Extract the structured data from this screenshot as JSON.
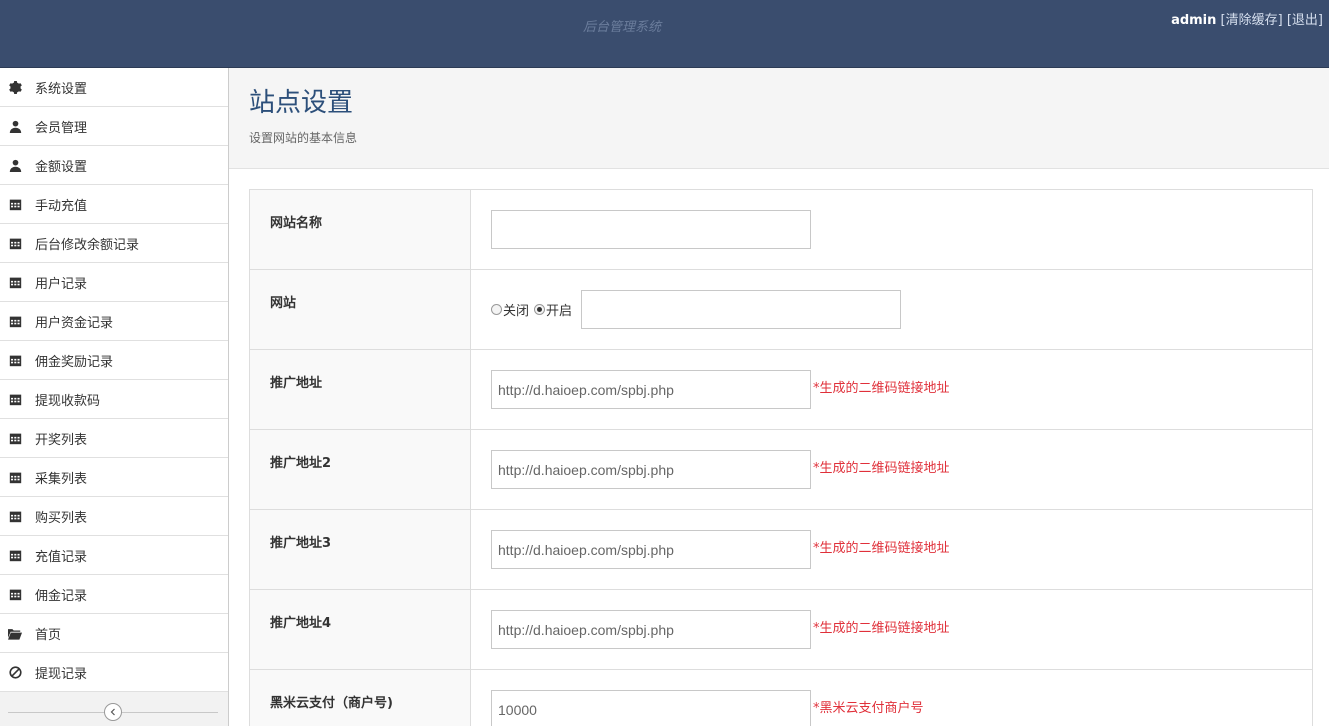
{
  "header": {
    "brand": "后台管理系统",
    "username": "admin",
    "clear_cache": "[清除缓存]",
    "logout": "[退出]"
  },
  "sidebar": {
    "items": [
      {
        "label": "系统设置",
        "icon": "gear-icon"
      },
      {
        "label": "会员管理",
        "icon": "user-icon"
      },
      {
        "label": "金额设置",
        "icon": "user-icon"
      },
      {
        "label": "手动充值",
        "icon": "calendar-icon"
      },
      {
        "label": "后台修改余额记录",
        "icon": "calendar-icon"
      },
      {
        "label": "用户记录",
        "icon": "calendar-icon"
      },
      {
        "label": "用户资金记录",
        "icon": "calendar-icon"
      },
      {
        "label": "佣金奖励记录",
        "icon": "calendar-icon"
      },
      {
        "label": "提现收款码",
        "icon": "calendar-icon"
      },
      {
        "label": "开奖列表",
        "icon": "calendar-icon"
      },
      {
        "label": "采集列表",
        "icon": "calendar-icon"
      },
      {
        "label": "购买列表",
        "icon": "calendar-icon"
      },
      {
        "label": "充值记录",
        "icon": "calendar-icon"
      },
      {
        "label": "佣金记录",
        "icon": "calendar-icon"
      },
      {
        "label": "首页",
        "icon": "folder-open-icon"
      },
      {
        "label": "提现记录",
        "icon": "ban-icon"
      }
    ],
    "collapse_icon": "chevron-left-icon"
  },
  "page": {
    "title": "站点设置",
    "subtitle": "设置网站的基本信息"
  },
  "form": {
    "site_name": {
      "label": "网站名称",
      "value": ""
    },
    "site_status": {
      "label": "网站",
      "option_off": "关闭",
      "option_on": "开启",
      "selected": "开启",
      "value": ""
    },
    "promo_1": {
      "label": "推广地址",
      "value": "http://d.haioep.com/spbj.php",
      "hint": "*生成的二维码链接地址"
    },
    "promo_2": {
      "label": "推广地址2",
      "value": "http://d.haioep.com/spbj.php",
      "hint": "*生成的二维码链接地址"
    },
    "promo_3": {
      "label": "推广地址3",
      "value": "http://d.haioep.com/spbj.php",
      "hint": "*生成的二维码链接地址"
    },
    "promo_4": {
      "label": "推广地址4",
      "value": "http://d.haioep.com/spbj.php",
      "hint": "*生成的二维码链接地址"
    },
    "merchant_id": {
      "label": "黑米云支付（商户号)",
      "value": "10000",
      "hint": "*黑米云支付商户号"
    }
  },
  "colors": {
    "header_bg": "#3a4d6e",
    "title": "#2c4f7a",
    "hint": "#e0303a"
  }
}
